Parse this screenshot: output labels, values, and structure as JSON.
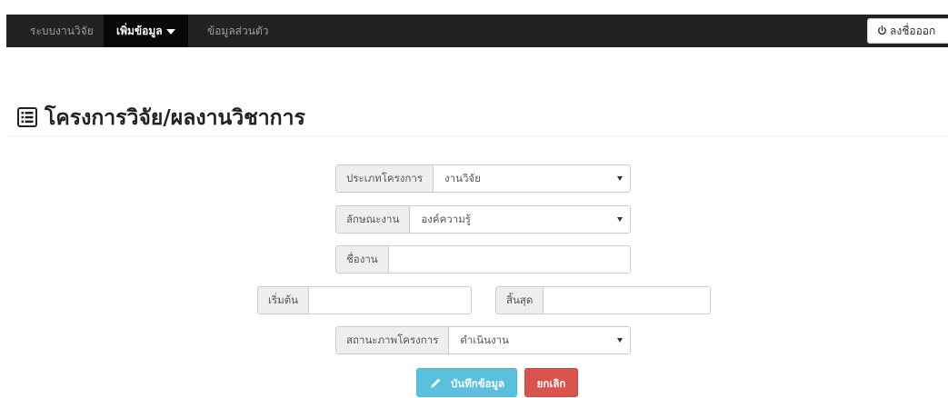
{
  "navbar": {
    "brand": "ระบบงานวิจัย",
    "add_menu": "เพิ่มข้อมูล",
    "profile": "ข้อมูลส่วนตัว",
    "logout": "ลงชื่อออก",
    "logout_icon": "power-icon"
  },
  "page": {
    "title": "โครงการวิจัย/ผลงานวิชาการ",
    "title_icon": "list-alt-icon"
  },
  "form": {
    "project_type": {
      "label": "ประเภทโครงการ",
      "value": "งานวิจัย"
    },
    "work_nature": {
      "label": "ลักษณะงาน",
      "value": "องค์ความรู้"
    },
    "work_name": {
      "label": "ชื่องาน",
      "value": ""
    },
    "start": {
      "label": "เริ่มต้น",
      "value": ""
    },
    "end": {
      "label": "สิ้นสุด",
      "value": ""
    },
    "status": {
      "label": "สถานะภาพโครงการ",
      "value": "ดำเนินงาน"
    }
  },
  "buttons": {
    "save": "บันทึกข้อมูล",
    "save_icon": "pencil-icon",
    "cancel": "ยกเลิก"
  },
  "colors": {
    "navbar": "#222222",
    "save": "#5bc0de",
    "cancel": "#d9534f"
  }
}
